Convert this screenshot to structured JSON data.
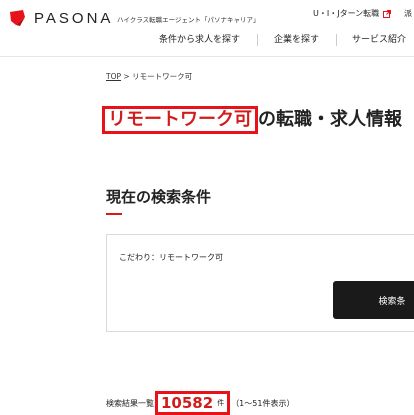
{
  "header": {
    "brand": "PASONA",
    "tagline": "ハイクラス転職エージェント「パソナキャリア」",
    "uturn_link": "U・I・Jターン転職",
    "cut_char": "派",
    "nav": [
      "条件から求人を探す",
      "企業を探す",
      "サービス紹介"
    ],
    "brand_color": "#e8121a"
  },
  "breadcrumb": {
    "top": "TOP",
    "separator": ">",
    "current": "リモートワーク可"
  },
  "title": {
    "highlight": "リモートワーク可",
    "rest": "の転職・求人情報"
  },
  "conditions": {
    "heading": "現在の検索条件",
    "criteria": "こだわり：リモートワーク可",
    "button": "検索条"
  },
  "results": {
    "label": "検索結果一覧",
    "count": "10582",
    "unit": "件",
    "range": "（1〜51件表示）"
  }
}
